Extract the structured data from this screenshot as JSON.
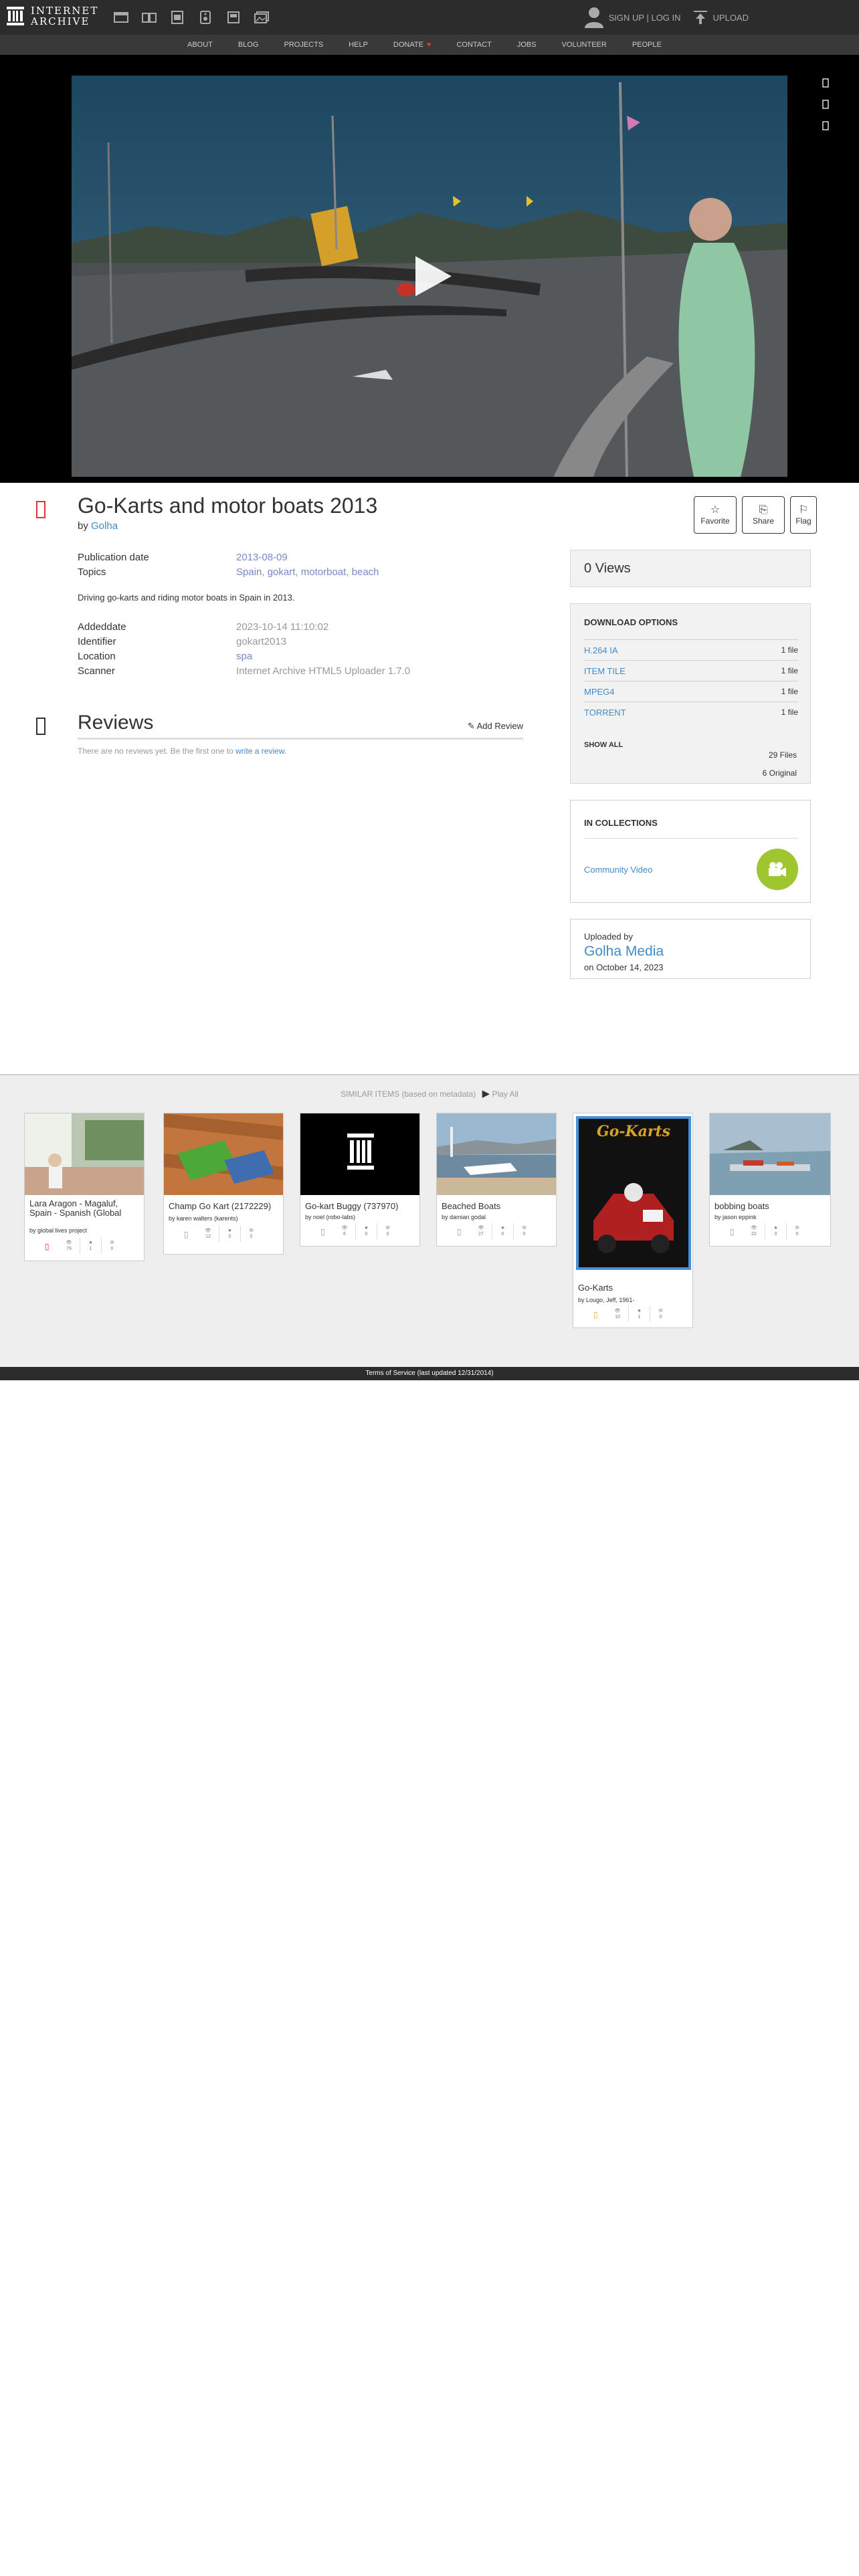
{
  "topbar": {
    "logo_line1": "INTERNET",
    "logo_line2": "ARCHIVE",
    "media_icons": [
      "web-icon",
      "texts-icon",
      "video-icon",
      "audio-icon",
      "software-icon",
      "images-icon"
    ],
    "signup": "SIGN UP | LOG IN",
    "upload": "UPLOAD"
  },
  "nav": {
    "items": [
      "ABOUT",
      "BLOG",
      "PROJECTS",
      "HELP",
      "DONATE",
      "CONTACT",
      "JOBS",
      "VOLUNTEER",
      "PEOPLE"
    ]
  },
  "item": {
    "title": "Go-Karts and motor boats 2013",
    "by_label": "by",
    "creator": "Golha",
    "actions": {
      "favorite": "Favorite",
      "share": "Share",
      "flag": "Flag"
    },
    "metadata": [
      {
        "key": "Publication date",
        "value": "2013-08-09"
      }
    ],
    "topics_key": "Topics",
    "topics": [
      "Spain",
      "gokart",
      "motorboat",
      "beach"
    ],
    "description": "Driving go-karts and riding motor boats in Spain in 2013.",
    "metadata2": [
      {
        "key": "Addeddate",
        "value": "2023-10-14 11:10:02"
      },
      {
        "key": "Identifier",
        "value": "gokart2013"
      },
      {
        "key": "Location",
        "value": "spa"
      },
      {
        "key": "Scanner",
        "value": "Internet Archive HTML5 Uploader 1.7.0"
      }
    ]
  },
  "reviews": {
    "title": "Reviews",
    "add": "Add Review",
    "empty_text": "There are no reviews yet. Be the first one to",
    "write_link": "write a review."
  },
  "sidebar": {
    "views": "0 Views",
    "download_header": "DOWNLOAD OPTIONS",
    "downloads": [
      {
        "label": "H.264 IA",
        "files": "1 file"
      },
      {
        "label": "ITEM TILE",
        "files": "1 file"
      },
      {
        "label": "MPEG4",
        "files": "1 file"
      },
      {
        "label": "TORRENT",
        "files": "1 file"
      }
    ],
    "show_all": "SHOW ALL",
    "total_files": "29 Files",
    "original_files": "6 Original",
    "collections_header": "IN COLLECTIONS",
    "collection": "Community Video",
    "uploaded_by": "Uploaded by",
    "uploader": "Golha Media",
    "upload_date": "on October 14, 2023"
  },
  "similar": {
    "heading": "SIMILAR ITEMS (based on metadata)",
    "play_all": "Play All",
    "items": [
      {
        "title": "Lara Aragon - Magaluf, Spain - Spanish (Global",
        "by": "by global lives project",
        "views": "79",
        "favs": "1",
        "reviews": "0"
      },
      {
        "title": "Champ Go Kart (2172229)",
        "by": "by karen walters (karents)",
        "views": "12",
        "favs": "0",
        "reviews": "0"
      },
      {
        "title": "Go-kart Buggy (737970)",
        "by": "by noel (robo-labs)",
        "views": "6",
        "favs": "0",
        "reviews": "0"
      },
      {
        "title": "Beached Boats",
        "by": "by damian godal",
        "views": "27",
        "favs": "0",
        "reviews": "0"
      },
      {
        "title": "Go-Karts",
        "by": "by Lougo, Jeff, 1961-",
        "poster_text": "Go-Karts",
        "views": "10",
        "favs": "1",
        "reviews": "0"
      },
      {
        "title": "bobbing boats",
        "by": "by jason eppink",
        "views": "22",
        "favs": "0",
        "reviews": "0"
      }
    ]
  },
  "footer": "Terms of Service (last updated 12/31/2014)",
  "colors": {
    "link": "#428bca",
    "accent_red": "#e4323b",
    "collection_badge": "#9fc52f"
  }
}
